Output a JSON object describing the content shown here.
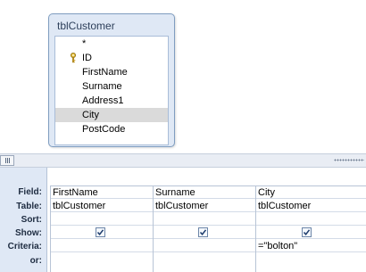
{
  "table": {
    "title": "tblCustomer",
    "fields": [
      {
        "label": "*",
        "key": false,
        "selected": false
      },
      {
        "label": "ID",
        "key": true,
        "selected": false
      },
      {
        "label": "FirstName",
        "key": false,
        "selected": false
      },
      {
        "label": "Surname",
        "key": false,
        "selected": false
      },
      {
        "label": "Address1",
        "key": false,
        "selected": false
      },
      {
        "label": "City",
        "key": false,
        "selected": true
      },
      {
        "label": "PostCode",
        "key": false,
        "selected": false
      }
    ]
  },
  "grid": {
    "row_labels": [
      "Field:",
      "Table:",
      "Sort:",
      "Show:",
      "Criteria:",
      "or:"
    ],
    "columns": [
      {
        "field": "FirstName",
        "table": "tblCustomer",
        "sort": "",
        "show": true,
        "criteria": "",
        "or": ""
      },
      {
        "field": "Surname",
        "table": "tblCustomer",
        "sort": "",
        "show": true,
        "criteria": "",
        "or": ""
      },
      {
        "field": "City",
        "table": "tblCustomer",
        "sort": "",
        "show": true,
        "criteria": "=\"bolton\"",
        "or": ""
      }
    ]
  },
  "icons": {
    "key": "primary-key-icon",
    "check": "checkmark-icon"
  },
  "colors": {
    "table_header": "#dfe8f5",
    "selected_row": "#dadada",
    "grid_border": "#b8c4d6"
  }
}
